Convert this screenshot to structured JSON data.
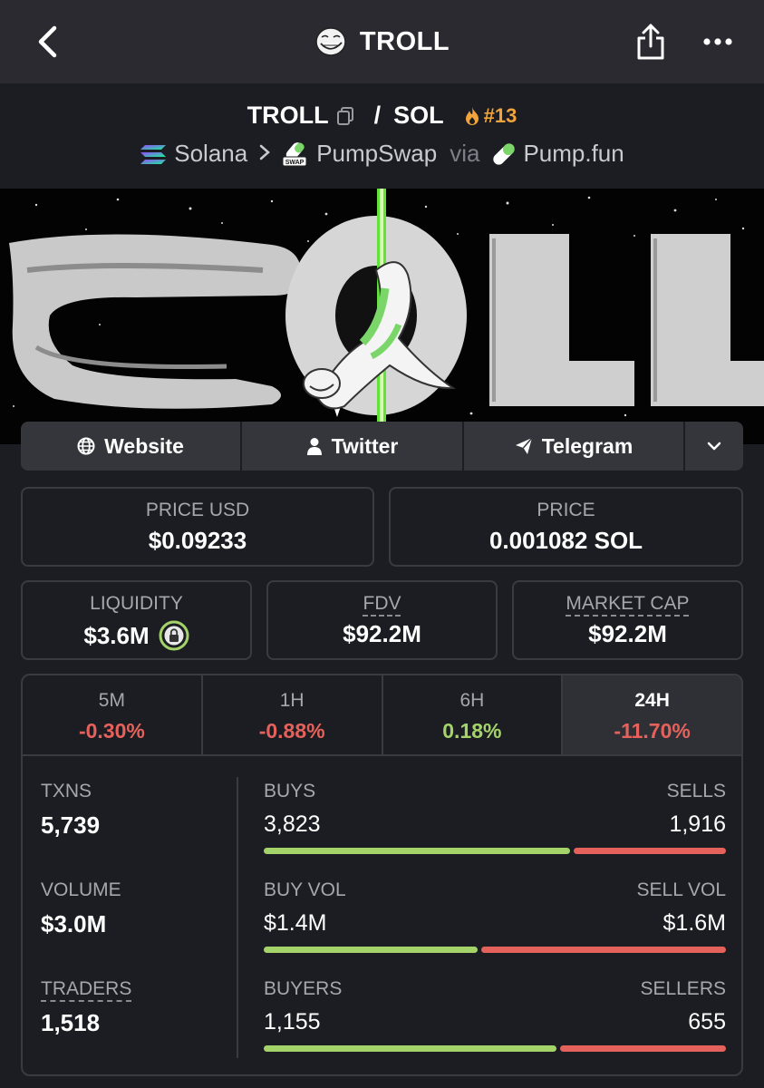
{
  "nav": {
    "title": "TROLL",
    "icons": {
      "back": "chevron-left-icon",
      "share": "share-icon",
      "more": "more-dots-icon",
      "token": "troll-face-icon"
    }
  },
  "pair": {
    "base": "TROLL",
    "slash": "/",
    "quote": "SOL",
    "rank": "#13",
    "chain": "Solana",
    "dex": "PumpSwap",
    "via": "via",
    "launchpad": "Pump.fun"
  },
  "banner": {
    "text": "OLL"
  },
  "links": [
    {
      "label": "Website",
      "icon": "globe-icon"
    },
    {
      "label": "Twitter",
      "icon": "user-icon"
    },
    {
      "label": "Telegram",
      "icon": "paper-plane-icon"
    }
  ],
  "stats": {
    "price_usd": {
      "label": "PRICE USD",
      "value": "$0.09233"
    },
    "price": {
      "label": "PRICE",
      "value": "0.001082 SOL"
    },
    "liquidity": {
      "label": "LIQUIDITY",
      "value": "$3.6M"
    },
    "fdv": {
      "label": "FDV",
      "value": "$92.2M"
    },
    "market_cap": {
      "label": "MARKET CAP",
      "value": "$92.2M"
    }
  },
  "timeframes": [
    {
      "label": "5M",
      "change": "-0.30%",
      "trend": "neg",
      "active": false
    },
    {
      "label": "1H",
      "change": "-0.88%",
      "trend": "neg",
      "active": false
    },
    {
      "label": "6H",
      "change": "0.18%",
      "trend": "pos",
      "active": false
    },
    {
      "label": "24H",
      "change": "-11.70%",
      "trend": "neg",
      "active": true
    }
  ],
  "metrics": {
    "txns": {
      "label": "TXNS",
      "value": "5,739"
    },
    "volume": {
      "label": "VOLUME",
      "value": "$3.0M"
    },
    "traders": {
      "label": "TRADERS",
      "value": "1,518"
    }
  },
  "breakdown": {
    "txns": {
      "left_label": "BUYS",
      "left_value": "3,823",
      "right_label": "SELLS",
      "right_value": "1,916",
      "buy_fraction": 0.666
    },
    "volume": {
      "left_label": "BUY VOL",
      "left_value": "$1.4M",
      "right_label": "SELL VOL",
      "right_value": "$1.6M",
      "buy_fraction": 0.467
    },
    "traders": {
      "left_label": "BUYERS",
      "left_value": "1,155",
      "right_label": "SELLERS",
      "right_value": "655",
      "buy_fraction": 0.638
    }
  },
  "colors": {
    "buy": "#a4d36a",
    "sell": "#e5625c",
    "rank": "#f0a43a",
    "background": "#1c1d22"
  }
}
